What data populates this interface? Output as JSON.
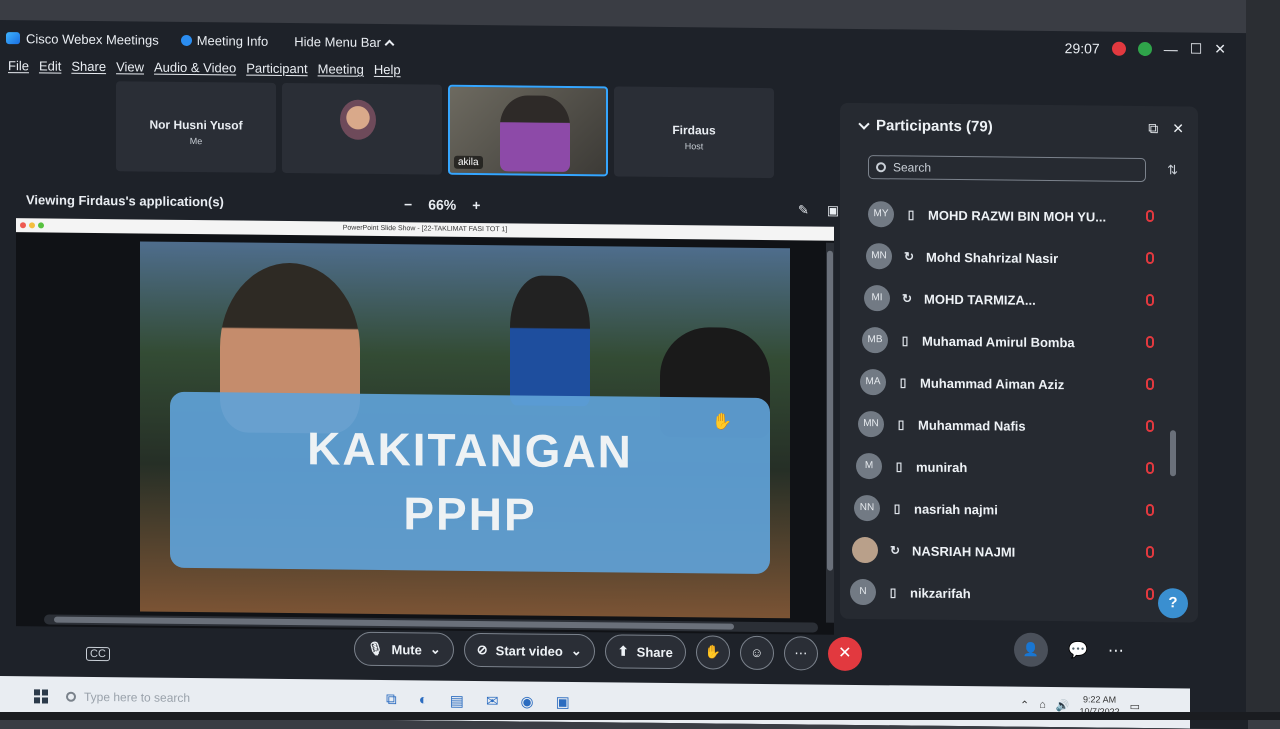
{
  "window": {
    "app_title": "Cisco Webex Meetings",
    "meeting_info": "Meeting Info",
    "hide_menu": "Hide Menu Bar",
    "timer": "29:07"
  },
  "menu": [
    "File",
    "Edit",
    "Share",
    "View",
    "Audio & Video",
    "Participant",
    "Meeting",
    "Help"
  ],
  "videos": [
    {
      "name": "Nor Husni Yusof",
      "sub": "Me"
    },
    {
      "name": "",
      "sub": ""
    },
    {
      "name": "akila",
      "sub": ""
    },
    {
      "name": "Firdaus",
      "sub": "Host"
    }
  ],
  "viewing": "Viewing Firdaus's application(s)",
  "zoom": {
    "minus": "−",
    "value": "66%",
    "plus": "+"
  },
  "shared_window_title": "PowerPoint Slide Show - [22-TAKLIMAT FASI TOT 1]",
  "slide": {
    "line1": "KAKITANGAN",
    "line2": "PPHP"
  },
  "participants": {
    "title": "Participants (79)",
    "search_placeholder": "Search",
    "list": [
      {
        "initials": "MY",
        "name": "MOHD RAZWI BIN MOH YU...",
        "device": "phone"
      },
      {
        "initials": "MN",
        "name": "Mohd Shahrizal Nasir",
        "device": "sync"
      },
      {
        "initials": "MI",
        "name": "MOHD TARMIZA...",
        "device": "sync"
      },
      {
        "initials": "MB",
        "name": "Muhamad Amirul Bomba",
        "device": "phone"
      },
      {
        "initials": "MA",
        "name": "Muhammad Aiman Aziz",
        "device": "phone"
      },
      {
        "initials": "MN",
        "name": "Muhammad Nafis",
        "device": "phone"
      },
      {
        "initials": "M",
        "name": "munirah",
        "device": "phone"
      },
      {
        "initials": "NN",
        "name": "nasriah najmi",
        "device": "phone"
      },
      {
        "initials": "",
        "name": "NASRIAH NAJMI",
        "device": "sync"
      },
      {
        "initials": "N",
        "name": "nikzarifah",
        "device": "phone"
      }
    ]
  },
  "controls": {
    "mute": "Mute",
    "start_video": "Start video",
    "share": "Share"
  },
  "taskbar": {
    "search_placeholder": "Type here to search",
    "time": "9:22 AM",
    "date": "10/7/2022"
  },
  "colors": {
    "accent": "#35a6ff",
    "leave": "#e2393f",
    "panel": "#262a31"
  }
}
